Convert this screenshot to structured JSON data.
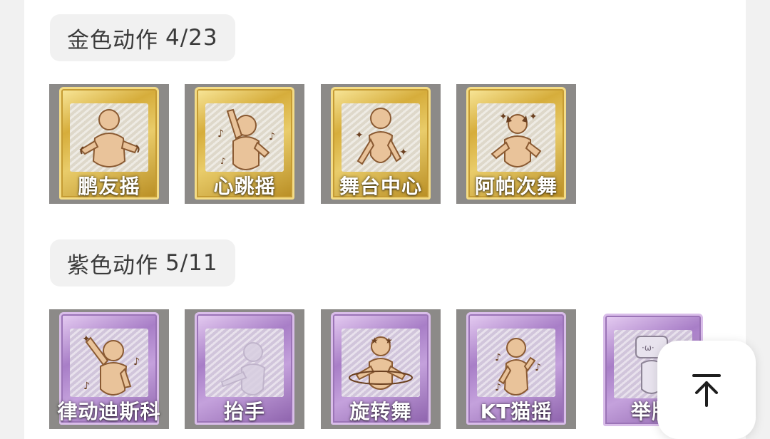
{
  "sections": [
    {
      "title": "金色动作",
      "count": "4/23",
      "color": "#d6ad3b",
      "items": [
        {
          "label": "鹏友摇",
          "icon": "dance-figure-icon"
        },
        {
          "label": "心跳摇",
          "icon": "dance-figure-icon"
        },
        {
          "label": "舞台中心",
          "icon": "dance-figure-icon"
        },
        {
          "label": "阿帕次舞",
          "icon": "dance-figure-icon"
        }
      ]
    },
    {
      "title": "紫色动作",
      "count": "5/11",
      "color": "#a87ec7",
      "items": [
        {
          "label": "律动迪斯科",
          "icon": "dance-figure-icon"
        },
        {
          "label": "抬手",
          "icon": "dance-figure-icon"
        },
        {
          "label": "旋转舞",
          "icon": "dance-figure-icon"
        },
        {
          "label": "KT猫摇",
          "icon": "dance-figure-icon"
        },
        {
          "label": "举牌",
          "icon": "sign-holding-figure-icon"
        }
      ]
    }
  ],
  "back_to_top": {
    "icon": "arrow-up-to-top-icon"
  }
}
